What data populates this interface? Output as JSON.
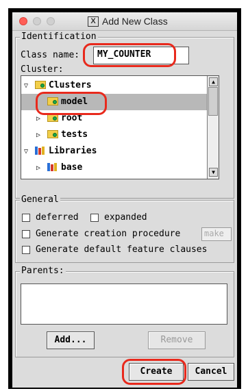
{
  "window": {
    "title": "Add New Class",
    "x11_glyph": "X"
  },
  "identification": {
    "group_label": "Identification",
    "class_name_label": "Class name:",
    "class_name_value": "MY_COUNTER",
    "cluster_label": "Cluster:"
  },
  "cluster_tree": [
    {
      "label": "Clusters",
      "expanded": true,
      "icon": "cluster-folder-icon",
      "level": 0
    },
    {
      "label": "model",
      "selected": true,
      "icon": "cluster-folder-icon",
      "level": 1
    },
    {
      "label": "root",
      "expanded": false,
      "icon": "cluster-folder-icon",
      "level": 1
    },
    {
      "label": "tests",
      "expanded": false,
      "icon": "cluster-folder-icon",
      "level": 1
    },
    {
      "label": "Libraries",
      "expanded": true,
      "icon": "library-icon",
      "level": 0
    },
    {
      "label": "base",
      "expanded": false,
      "icon": "library-icon",
      "level": 1
    }
  ],
  "general": {
    "group_label": "General",
    "deferred_label": "deferred",
    "expanded_label": "expanded",
    "creation_label": "Generate creation procedure",
    "creation_value": "make",
    "default_label": "Generate default feature clauses",
    "deferred_checked": false,
    "expanded_checked": false,
    "creation_checked": false,
    "default_checked": false
  },
  "parents": {
    "group_label": "Parents:",
    "add_label": "Add...",
    "remove_label": "Remove"
  },
  "buttons": {
    "create": "Create",
    "cancel": "Cancel"
  },
  "colors": {
    "highlight_ring": "#e8291c",
    "selection": "#b8b8b8",
    "close_light": "#ff5f57"
  }
}
